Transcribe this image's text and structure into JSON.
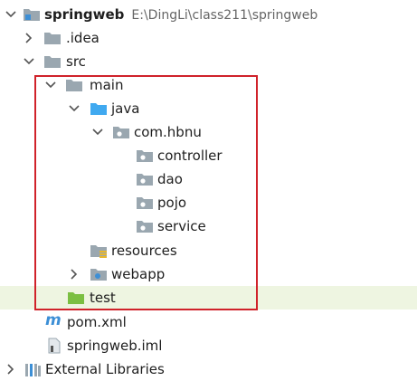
{
  "tree": {
    "project": {
      "name": "springweb",
      "path": "E:\\DingLi\\class211\\springweb"
    },
    "idea": ".idea",
    "src": "src",
    "main": "main",
    "java": "java",
    "package": "com.hbnu",
    "controller": "controller",
    "dao": "dao",
    "pojo": "pojo",
    "service": "service",
    "resources": "resources",
    "webapp": "webapp",
    "test": "test",
    "pom": "pom.xml",
    "iml": "springweb.iml",
    "external_libraries": "External Libraries"
  },
  "colors": {
    "folder_gray": "#9aa7b0",
    "folder_blue": "#40a9f0",
    "folder_green": "#7bbf42",
    "highlight_box": "#d0222a",
    "selected_row_bg": "#eef5e1",
    "maven_m": "#3c8fd6"
  },
  "icons": [
    "project-folder-icon",
    "folder-icon",
    "source-folder-icon",
    "package-icon",
    "resources-folder-icon",
    "web-folder-icon",
    "test-folder-icon",
    "maven-icon",
    "iml-file-icon",
    "libraries-icon",
    "chevron-down-icon",
    "chevron-right-icon"
  ]
}
